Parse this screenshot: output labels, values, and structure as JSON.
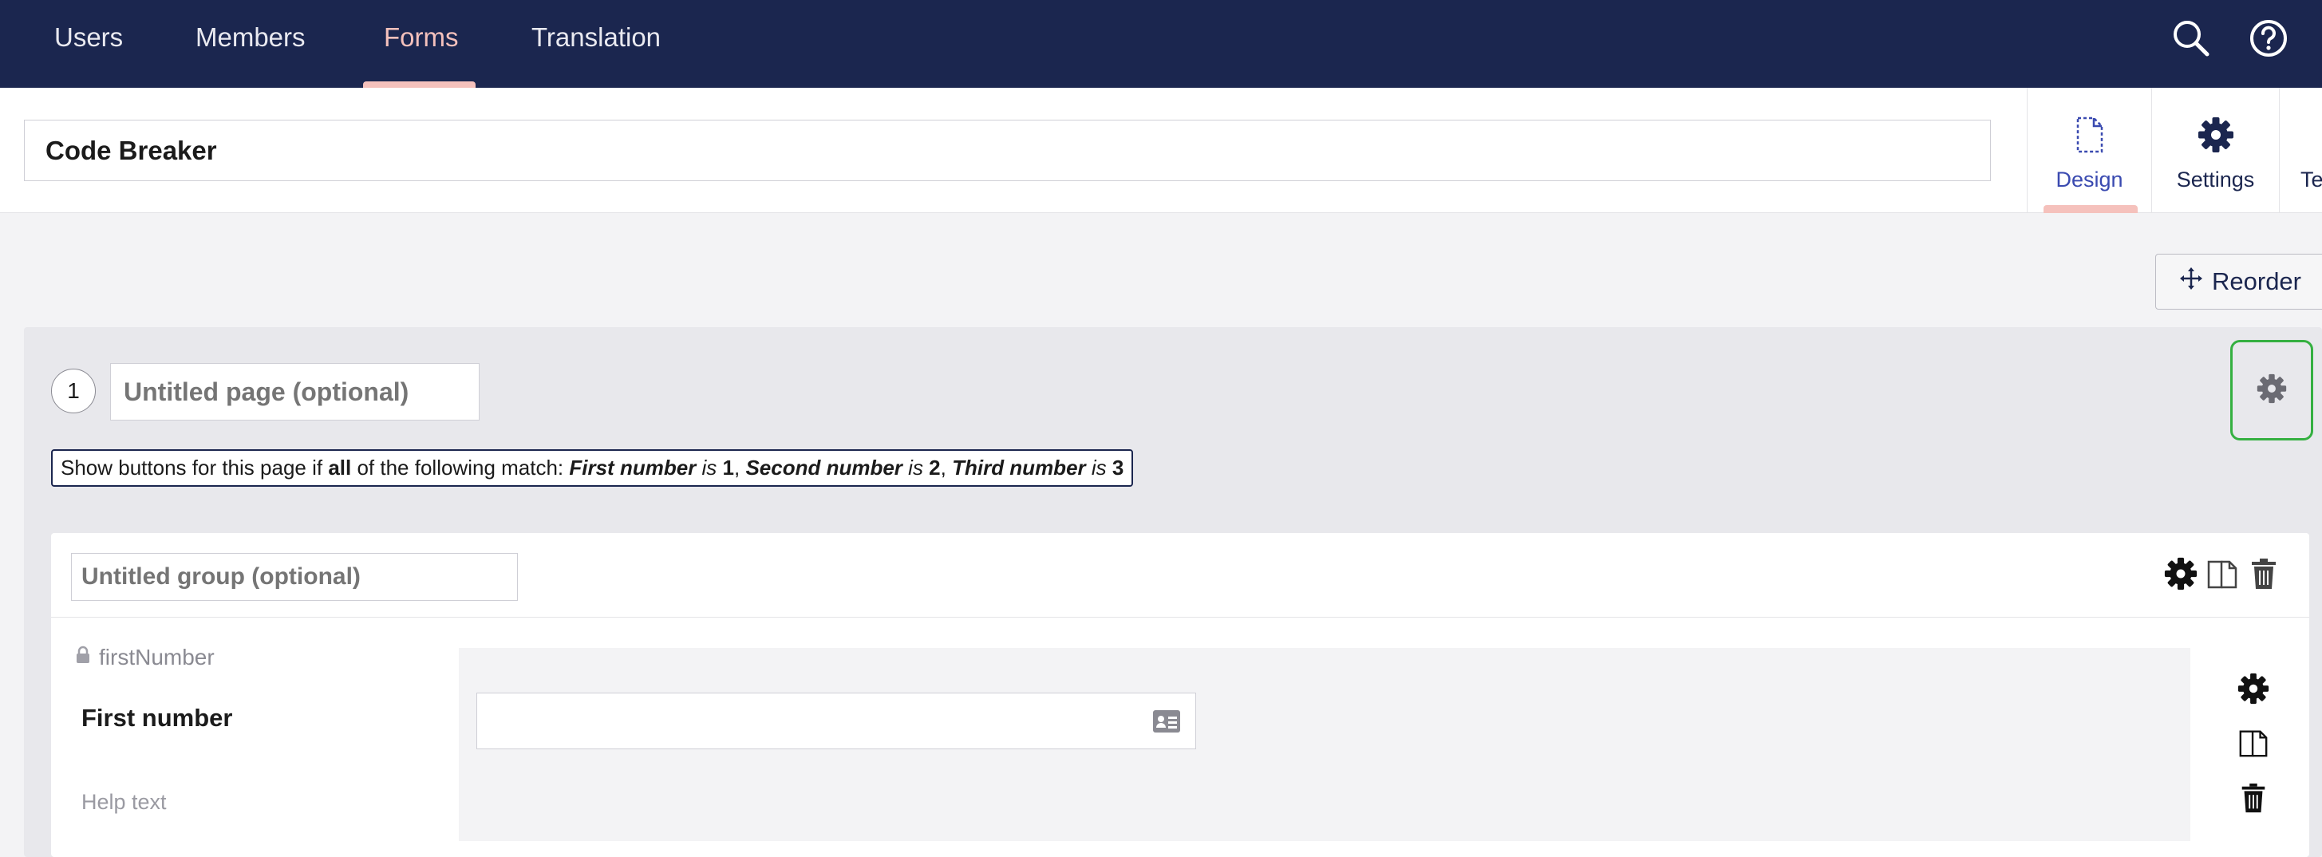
{
  "nav": {
    "items": [
      {
        "label": "Users",
        "active": false
      },
      {
        "label": "Members",
        "active": false
      },
      {
        "label": "Forms",
        "active": true
      },
      {
        "label": "Translation",
        "active": false
      }
    ],
    "icons": [
      "search-icon",
      "help-icon"
    ]
  },
  "form": {
    "name": "Code Breaker"
  },
  "app_tabs": [
    {
      "label": "Design",
      "icon": "document-icon",
      "active": true
    },
    {
      "label": "Settings",
      "icon": "gear-icon",
      "active": false
    },
    {
      "label": "Te",
      "icon": "",
      "active": false
    }
  ],
  "reorder": {
    "label": "Reorder"
  },
  "page": {
    "number": "1",
    "title_placeholder": "Untitled page (optional)",
    "condition": {
      "prefix": "Show buttons for this page if ",
      "match": "all",
      "mid": " of the following match: ",
      "rules": [
        {
          "field": "First number",
          "op": " is ",
          "value": "1",
          "sep": ", "
        },
        {
          "field": "Second number",
          "op": " is ",
          "value": "2",
          "sep": ", "
        },
        {
          "field": "Third number",
          "op": " is ",
          "value": "3",
          "sep": ""
        }
      ]
    }
  },
  "group": {
    "title_placeholder": "Untitled group (optional)"
  },
  "question": {
    "alias": "firstNumber",
    "label": "First number",
    "help": "Help text"
  },
  "colors": {
    "nav_bg": "#1b264f",
    "accent": "#f5c1bc",
    "highlight": "#35b041"
  }
}
